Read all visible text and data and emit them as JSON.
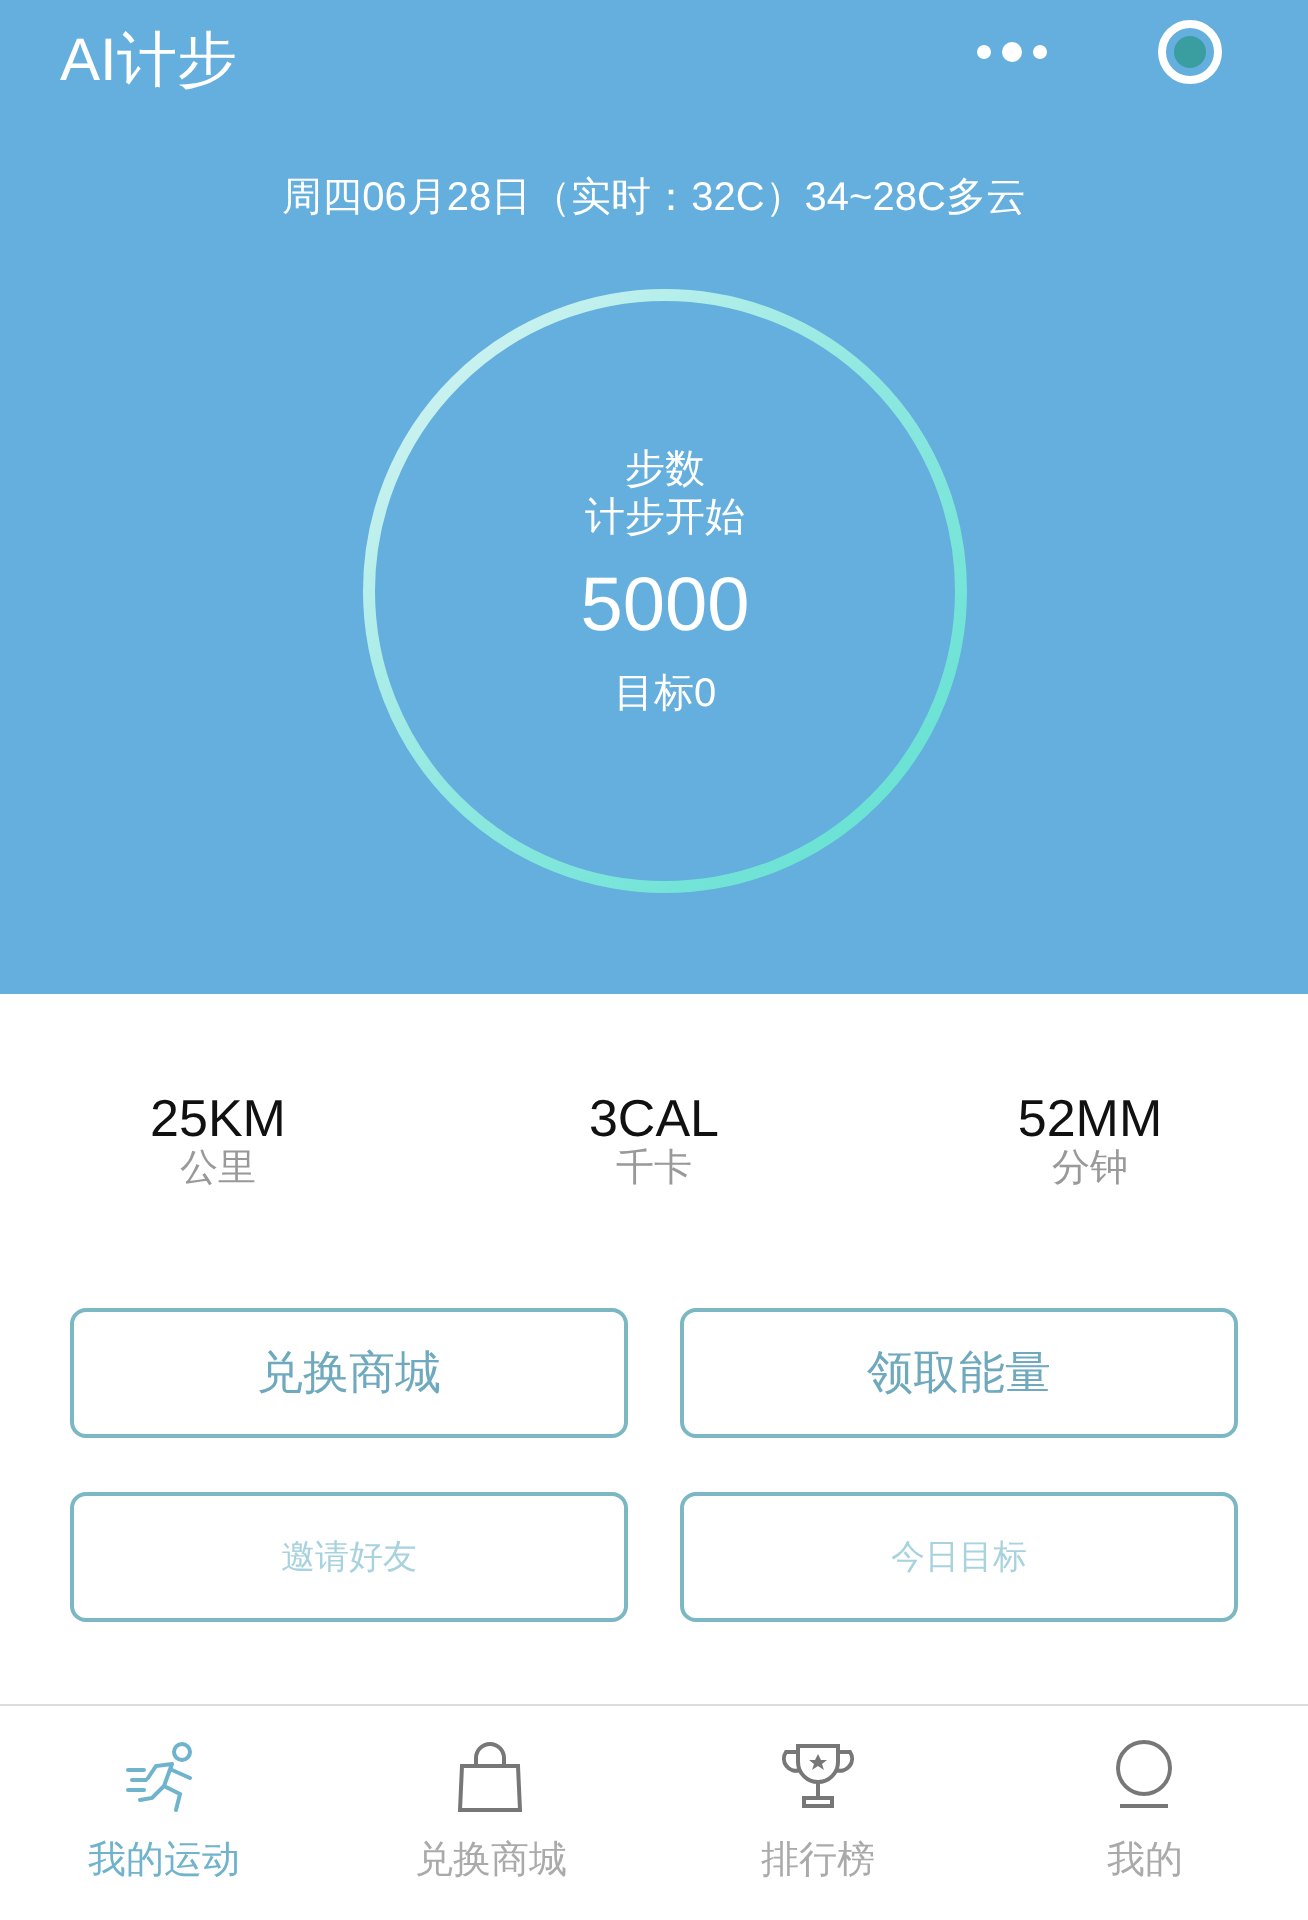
{
  "header": {
    "title": "AI计步",
    "weather": "周四06月28日（实时：32C）34~28C多云"
  },
  "ring": {
    "label": "步数",
    "status": "计步开始",
    "steps": "5000",
    "goal": "目标0"
  },
  "stats": [
    {
      "value": "25KM",
      "unit": "公里"
    },
    {
      "value": "3CAL",
      "unit": "千卡"
    },
    {
      "value": "52MM",
      "unit": "分钟"
    }
  ],
  "buttons": [
    {
      "label": "兑换商城",
      "kind": "primary"
    },
    {
      "label": "领取能量",
      "kind": "primary"
    },
    {
      "label": "邀请好友",
      "kind": "secondary"
    },
    {
      "label": "今日目标",
      "kind": "secondary"
    }
  ],
  "tabs": [
    {
      "label": "我的运动",
      "kind": "runner",
      "selected": true
    },
    {
      "label": "兑换商城",
      "kind": "bag",
      "selected": false
    },
    {
      "label": "排行榜",
      "kind": "trophy",
      "selected": false
    },
    {
      "label": "我的",
      "kind": "person",
      "selected": false
    }
  ]
}
